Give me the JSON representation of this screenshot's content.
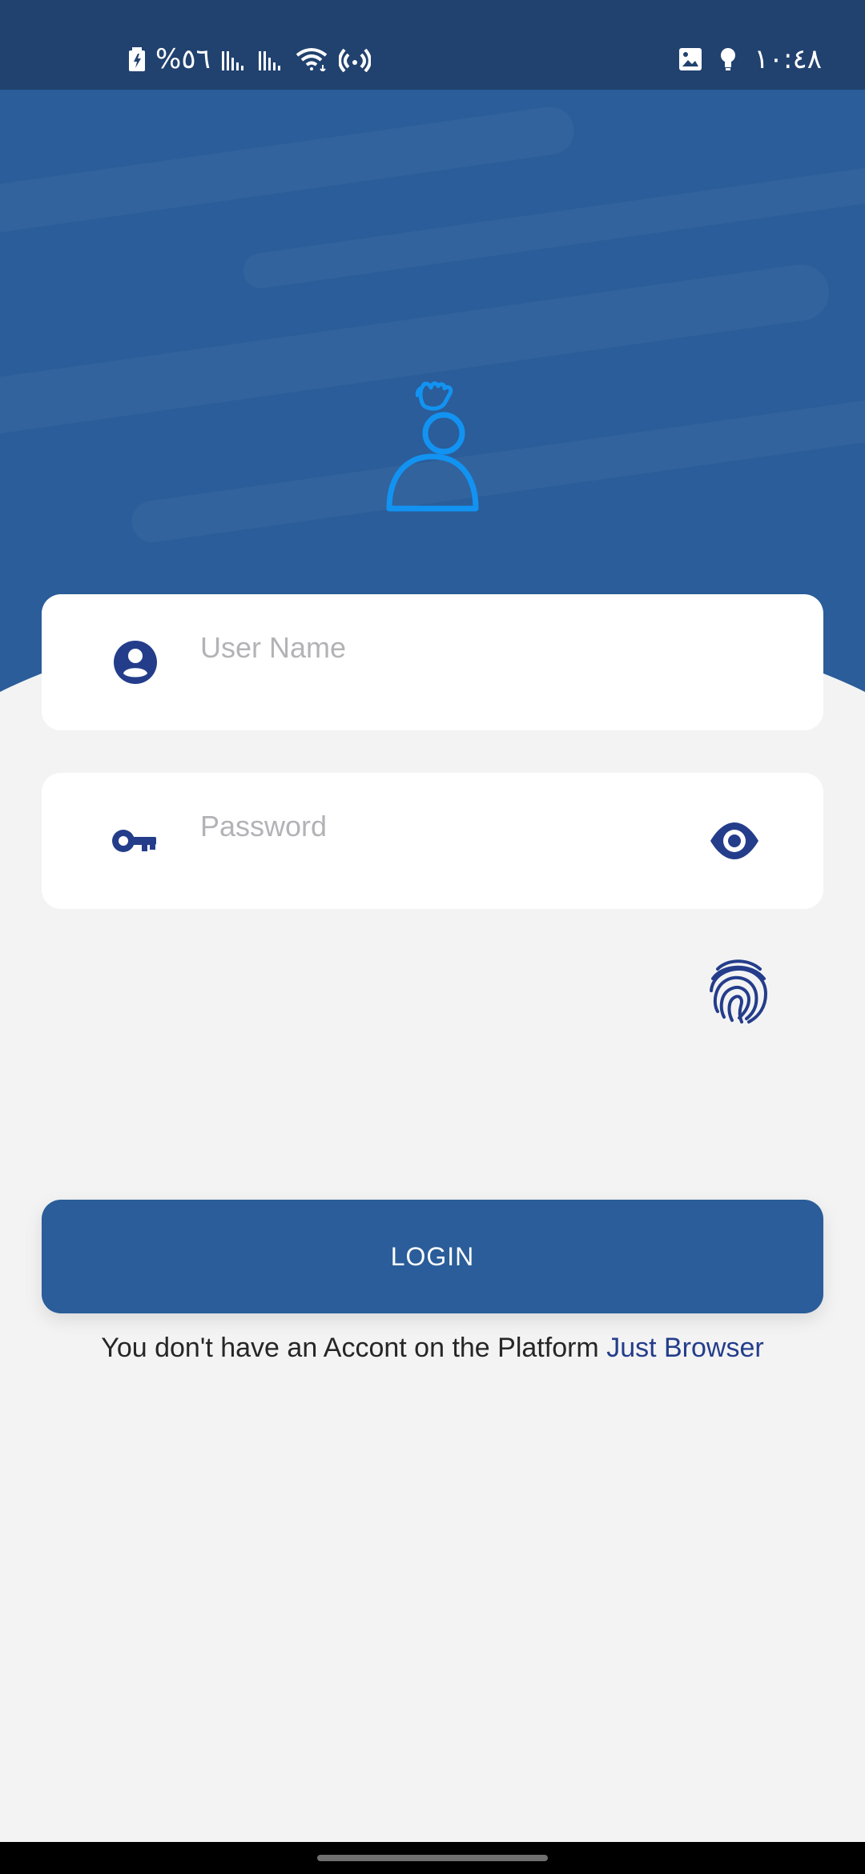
{
  "status": {
    "battery": "%٥٦",
    "time": "١٠:٤٨"
  },
  "icons": {
    "status_left": [
      "battery-charging-icon",
      "signal-icon",
      "signal-icon",
      "wifi-icon",
      "hotspot-icon"
    ],
    "status_right": [
      "image-icon",
      "bulb-icon"
    ],
    "hero": "waving-user-icon",
    "username": "user-circle-icon",
    "password": "key-icon",
    "visibility": "eye-icon",
    "biometric": "fingerprint-icon"
  },
  "colors": {
    "status_bar": "#21426f",
    "hero": "#2a5d99",
    "page_background": "#f3f3f4",
    "accent_icon": "#243d8b",
    "avatar_outline": "#1293f2",
    "button": "#2a5d99",
    "link": "#243d8b"
  },
  "form": {
    "username_placeholder": "User Name",
    "password_placeholder": "Password",
    "login_label": "LOGIN"
  },
  "footer": {
    "message": "You don't have an Accont on the Platform",
    "link_label": "Just Browser"
  }
}
